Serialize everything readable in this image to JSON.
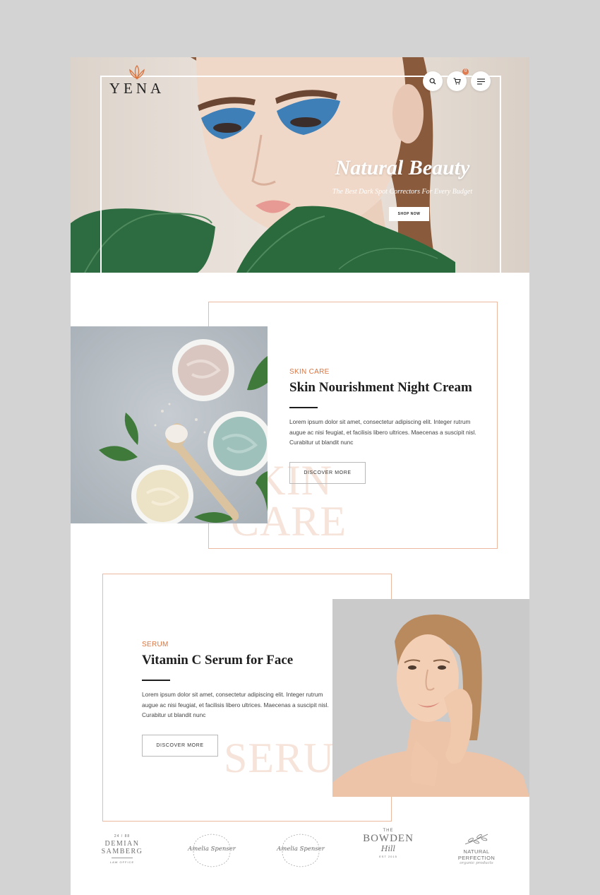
{
  "hero": {
    "logo": "YENA",
    "title": "Natural Beauty",
    "subtitle": "The Best Dark Spot Correctors For Every Budget",
    "cta": "SHOP NOW",
    "cart_count": "0",
    "icons": [
      "search-icon",
      "cart-icon",
      "menu-icon"
    ]
  },
  "section1": {
    "eyebrow": "SKIN CARE",
    "title": "Skin Nourishment Night Cream",
    "body": "Lorem ipsum dolor sit amet, consectetur adipiscing elit. Integer rutrum augue ac nisi feugiat, et facilisis libero ultrices. Maecenas a suscipit nisl. Curabitur ut blandit nunc",
    "button": "DISCOVER MORE",
    "bg_word_line1": "SKIN",
    "bg_word_line2": "CARE"
  },
  "section2": {
    "eyebrow": "SERUM",
    "title": "Vitamin C Serum for Face",
    "body": "Lorem ipsum dolor sit amet, consectetur adipiscing elit. Integer rutrum augue ac nisi feugiat, et facilisis libero ultrices. Maecenas a suscipit nisl. Curabitur ut blandit nunc",
    "button": "DISCOVER MORE",
    "bg_word": "SERUM"
  },
  "brands": [
    {
      "top": "24 / 88",
      "name1": "DEMIAN",
      "name2": "SAMBERG",
      "sub": "LAW OFFICE"
    },
    {
      "name": "Amelia Spenser"
    },
    {
      "name": "Amelia Spenser"
    },
    {
      "top": "THE",
      "name1": "BOWDEN",
      "name2": "Hill",
      "sub": "EST 2015"
    },
    {
      "name1": "NATURAL PERFECTION",
      "sub": "organic products"
    }
  ],
  "colors": {
    "accent": "#d9743f",
    "frame": "#eab9a0",
    "bg_word": "#f6e3da",
    "text_dark": "#1e1e1e"
  }
}
